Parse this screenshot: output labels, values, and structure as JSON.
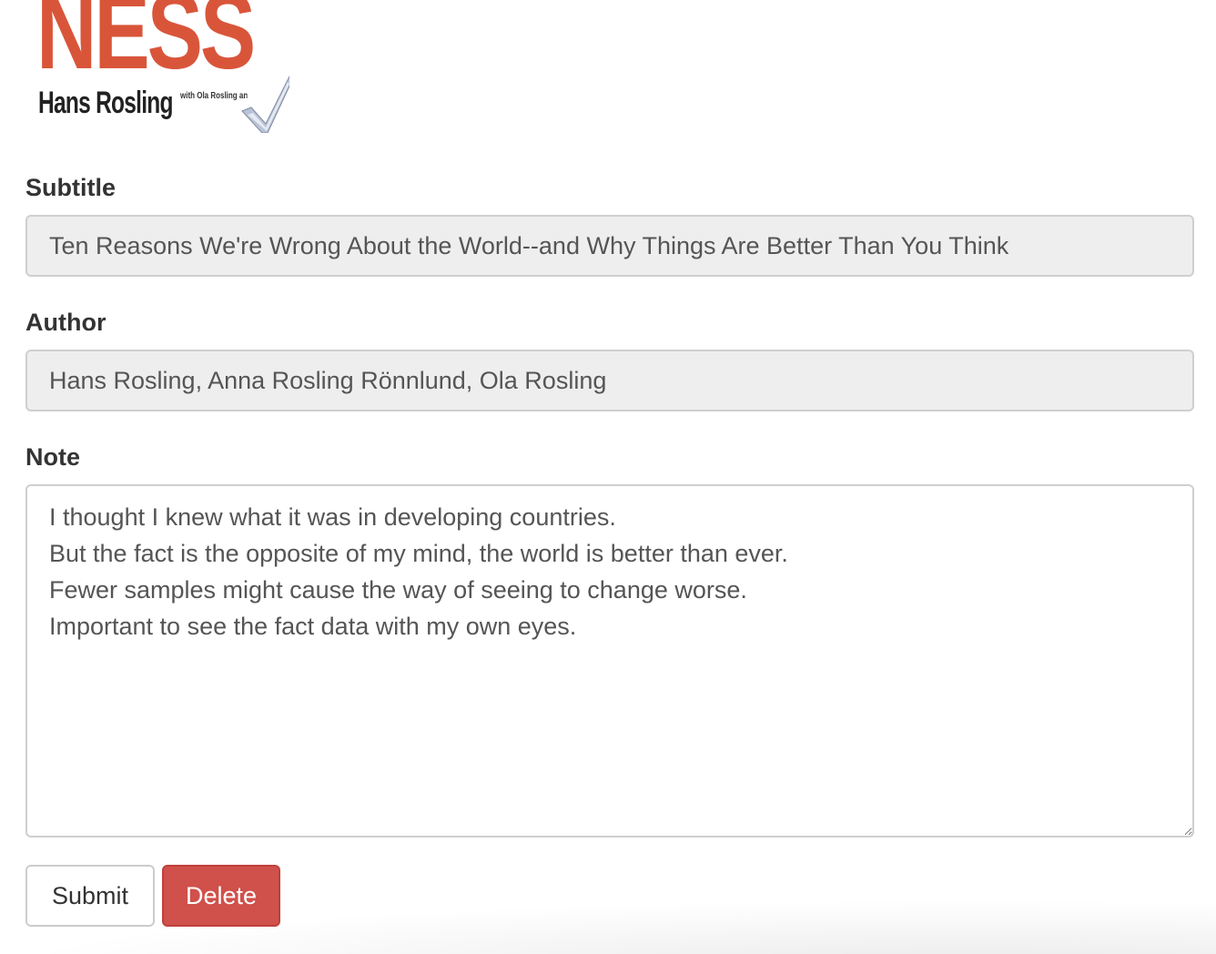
{
  "cover": {
    "title_fragment": "NESS",
    "author": "Hans Rosling",
    "coauthors": "with Ola Rosling and Anna Rosling Rö"
  },
  "form": {
    "subtitle_label": "Subtitle",
    "subtitle_value": "Ten Reasons We're Wrong About the World--and Why Things Are Better Than You Think",
    "author_label": "Author",
    "author_value": "Hans Rosling, Anna Rosling Rönnlund, Ola Rosling",
    "note_label": "Note",
    "note_value": "I thought I knew what it was in developing countries.\nBut the fact is the opposite of my mind, the world is better than ever.\nFewer samples might cause the way of seeing to change worse.\nImportant to see the fact data with my own eyes."
  },
  "buttons": {
    "submit_label": "Submit",
    "delete_label": "Delete"
  },
  "colors": {
    "cover_title": "#d9553a",
    "delete_button": "#d0504b",
    "readonly_field_bg": "#eeeeee"
  }
}
